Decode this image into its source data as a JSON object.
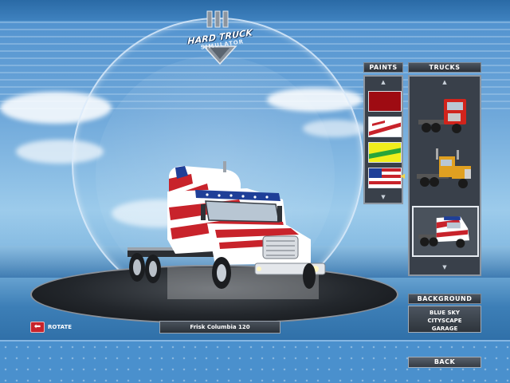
{
  "logo": {
    "title": "HARD TRUCK",
    "subtitle": "SIMULATOR"
  },
  "paints": {
    "header": "PAINTS",
    "swatches": [
      {
        "name": "dark-red",
        "color": "#9e0b12"
      },
      {
        "name": "red-stripes-on-white",
        "color": "#ffffff"
      },
      {
        "name": "yellow-green-stripes",
        "color": "#f0ee1c"
      },
      {
        "name": "us-flag",
        "color": "#c8232b"
      }
    ]
  },
  "trucks": {
    "header": "TRUCKS",
    "items": [
      {
        "name": "red-cabover-truck",
        "color": "#d1241c",
        "selected": false
      },
      {
        "name": "orange-conventional-truck",
        "color": "#e0a021",
        "selected": false
      },
      {
        "name": "flag-freightliner-truck",
        "color": "#ffffff",
        "selected": true
      }
    ]
  },
  "background": {
    "header": "BACKGROUND",
    "options": [
      "BLUE SKY",
      "CITYSCAPE",
      "GARAGE"
    ]
  },
  "rotate_label": "ROTATE",
  "truck_name": "Frisk Columbia 120",
  "back_label": "BACK",
  "colors": {
    "accent_red": "#c8232b",
    "flag_blue": "#1f3f98",
    "panel": "#39404a"
  }
}
